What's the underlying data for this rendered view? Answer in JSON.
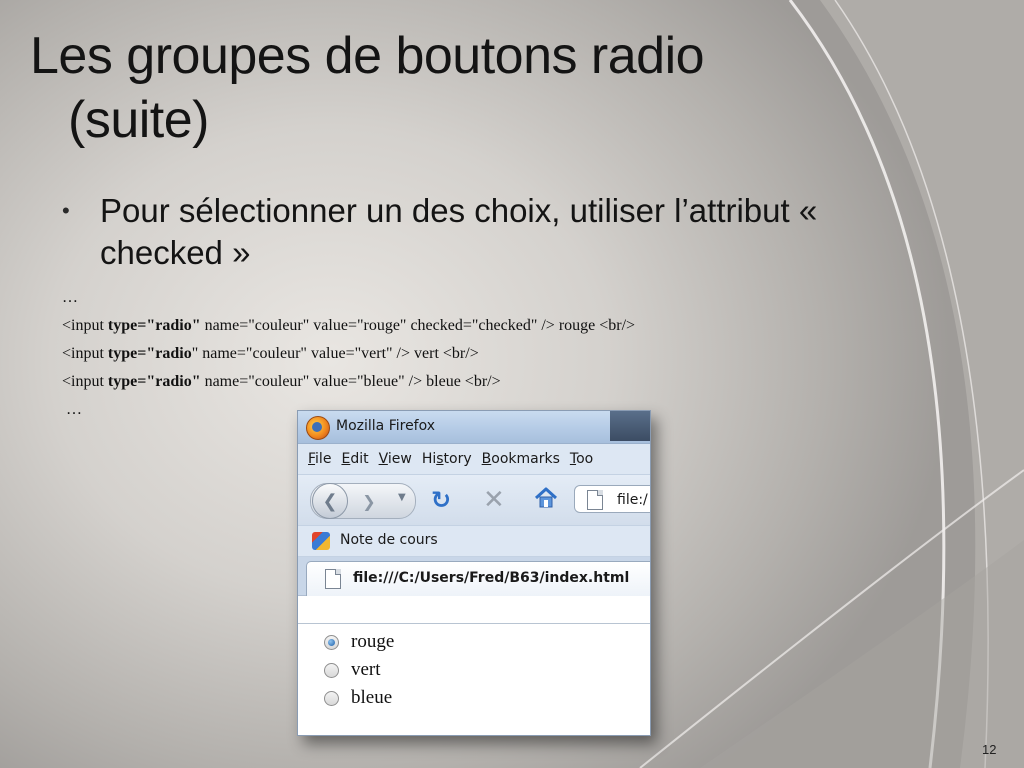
{
  "slide": {
    "title_line1": "Les groupes de boutons radio",
    "title_line2": "(suite)",
    "bullet_text": "Pour sélectionner un des choix, utiliser l’attribut « checked »",
    "ellipsis_top": "…",
    "ellipsis_bottom": "…",
    "code_lines": [
      {
        "pre": "<input ",
        "bold": "type=\"radio\"",
        "post": " name=\"couleur\" value=\"rouge\" checked=\"checked\" /> rouge <br/>"
      },
      {
        "pre": "<input ",
        "bold": "type=\"radio",
        "post": "\" name=\"couleur\" value=\"vert\" /> vert <br/>"
      },
      {
        "pre": "<input ",
        "bold": "type=\"radio\"",
        "post": " name=\"couleur\" value=\"bleue\" /> bleue <br/>"
      }
    ],
    "slide_number": "12"
  },
  "browser": {
    "window_title": "Mozilla Firefox",
    "menu": [
      {
        "u": "F",
        "rest": "ile"
      },
      {
        "u": "E",
        "rest": "dit"
      },
      {
        "u": "V",
        "rest": "iew"
      },
      {
        "pre": "Hi",
        "u": "s",
        "rest": "tory"
      },
      {
        "u": "B",
        "rest": "ookmarks"
      },
      {
        "u": "T",
        "rest": "oo"
      }
    ],
    "url_partial": "file:/",
    "bookmark_label": "Note de cours",
    "tab_url": "file:///C:/Users/Fred/B63/index.html",
    "radios": [
      {
        "label": "rouge",
        "checked": true
      },
      {
        "label": "vert",
        "checked": false
      },
      {
        "label": "bleue",
        "checked": false
      }
    ]
  },
  "icons": {
    "back": "back-arrow-icon",
    "forward": "forward-arrow-icon",
    "reload": "reload-icon",
    "stop": "stop-icon",
    "home": "home-icon",
    "page": "page-icon",
    "bookmark": "bookmark-favicon-icon",
    "firefox": "firefox-icon"
  }
}
